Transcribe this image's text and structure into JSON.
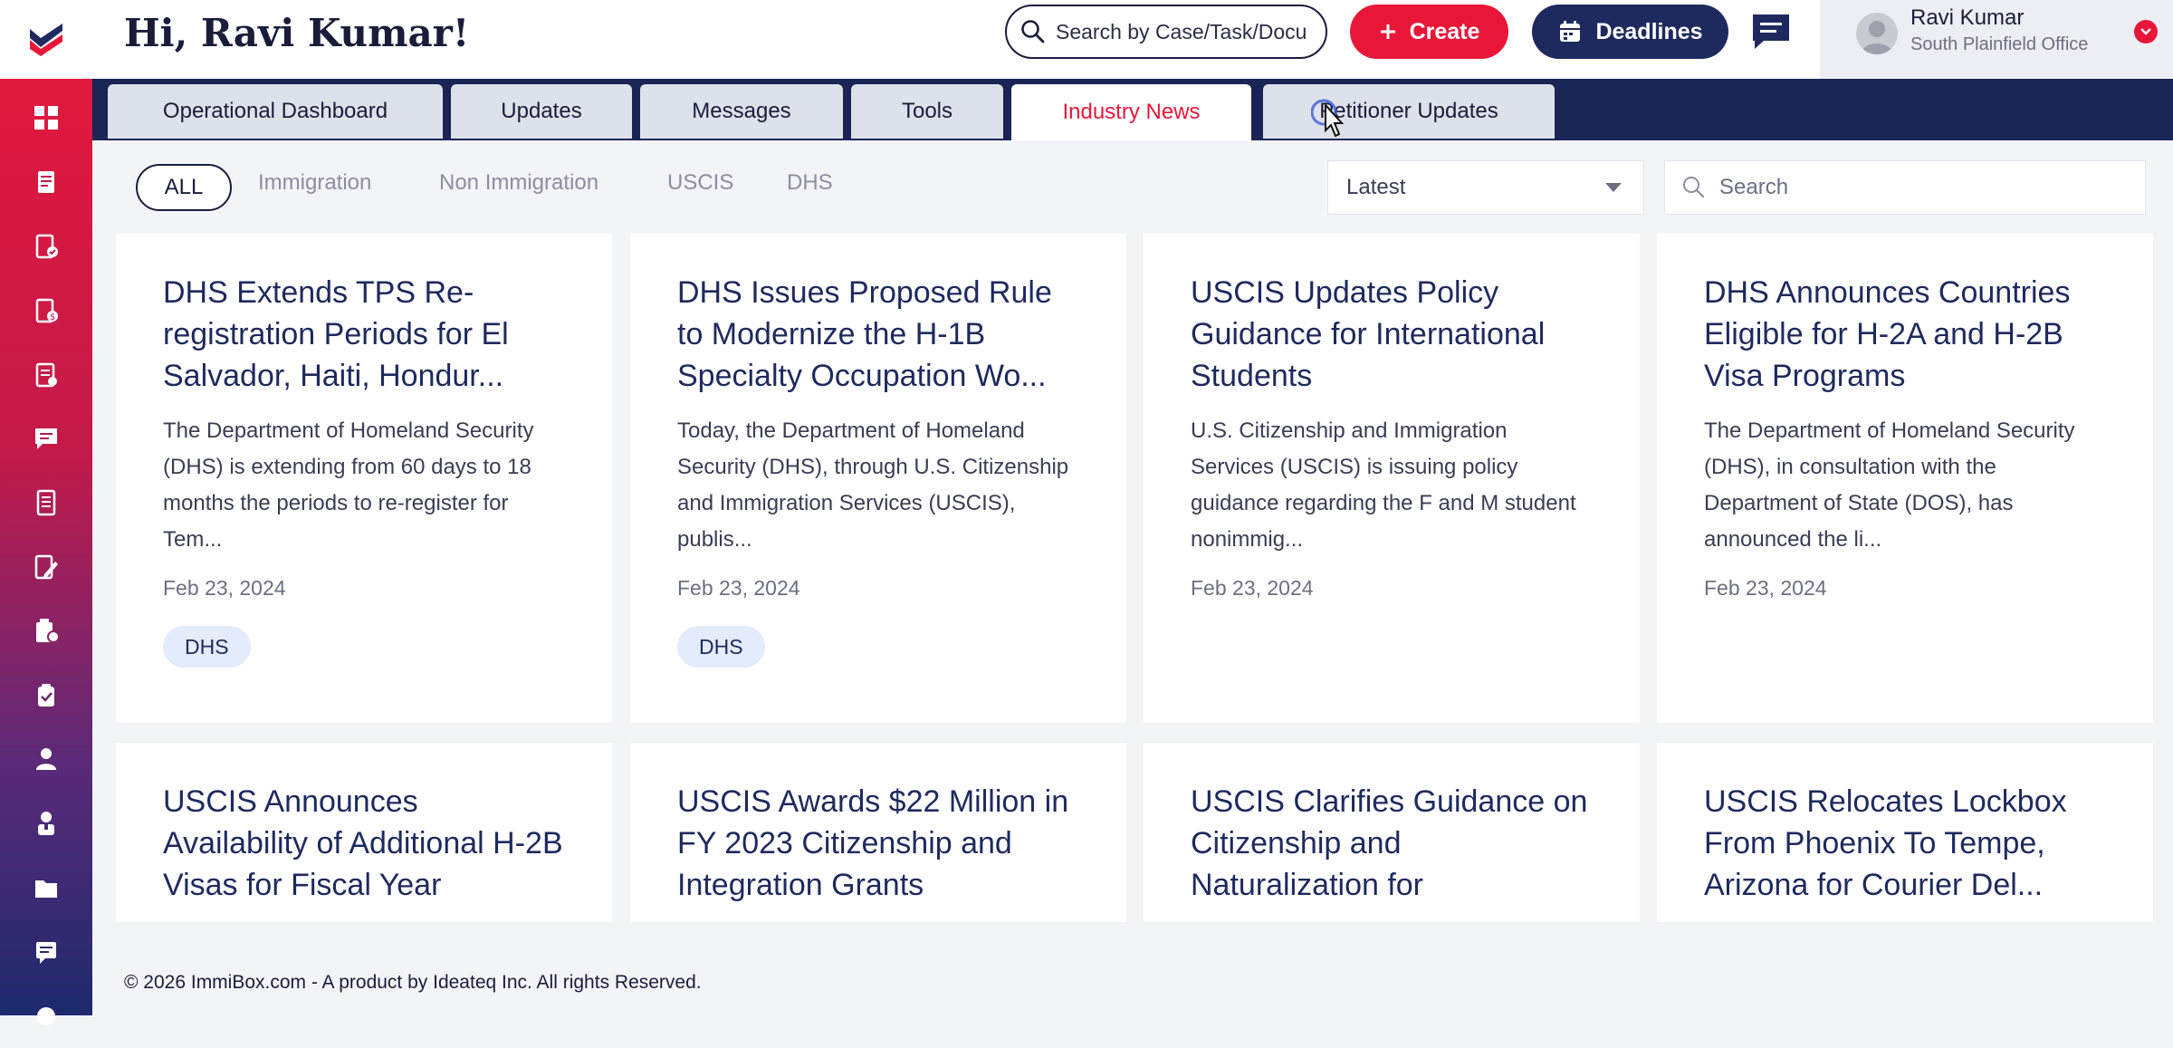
{
  "header": {
    "greeting": "Hi, Ravi Kumar!",
    "search_placeholder": "Search by Case/Task/Docu",
    "create_label": "Create",
    "deadlines_label": "Deadlines",
    "user_name": "Ravi Kumar",
    "user_office": "South Plainfield Office"
  },
  "sidebar": {
    "items": [
      {
        "icon": "dashboard-icon"
      },
      {
        "icon": "cases-icon"
      },
      {
        "icon": "forms-icon"
      },
      {
        "icon": "billing-icon"
      },
      {
        "icon": "checklist-icon"
      },
      {
        "icon": "messages-icon"
      },
      {
        "icon": "notes-icon"
      },
      {
        "icon": "edit-document-icon"
      },
      {
        "icon": "reports-icon"
      },
      {
        "icon": "tasks-icon"
      },
      {
        "icon": "user-icon"
      },
      {
        "icon": "contacts-icon"
      },
      {
        "icon": "folder-icon"
      },
      {
        "icon": "chat-icon"
      },
      {
        "icon": "help-icon"
      }
    ]
  },
  "tabs": [
    {
      "label": "Operational Dashboard",
      "active": false
    },
    {
      "label": "Updates",
      "active": false
    },
    {
      "label": "Messages",
      "active": false
    },
    {
      "label": "Tools",
      "active": false
    },
    {
      "label": "Industry News",
      "active": true
    },
    {
      "label": "Petitioner Updates",
      "active": false
    }
  ],
  "filters": {
    "chips": [
      "ALL",
      "Immigration",
      "Non Immigration",
      "USCIS",
      "DHS"
    ],
    "selected": "ALL",
    "sort_value": "Latest",
    "search_placeholder": "Search"
  },
  "articles": [
    {
      "title": "DHS Extends TPS Re-registration Periods for El Salvador, Haiti, Hondur...",
      "description": "The Department of Homeland Security (DHS) is extending from 60 days to 18 months the periods to re-register for Tem...",
      "date": "Feb 23, 2024",
      "tag": "DHS"
    },
    {
      "title": "DHS Issues Proposed Rule to Modernize the H-1B Specialty Occupation Wo...",
      "description": "Today, the Department of Homeland Security (DHS), through U.S. Citizenship and Immigration Services (USCIS), publis...",
      "date": "Feb 23, 2024",
      "tag": "DHS"
    },
    {
      "title": "USCIS Updates Policy Guidance for International Students",
      "description": "U.S. Citizenship and Immigration Services (USCIS) is issuing policy guidance regarding the F and M student nonimmig...",
      "date": "Feb 23, 2024",
      "tag": ""
    },
    {
      "title": "DHS Announces Countries Eligible for H-2A and H-2B Visa Programs",
      "description": "The Department of Homeland Security (DHS), in consultation with the Department of State (DOS), has announced the li...",
      "date": "Feb 23, 2024",
      "tag": ""
    },
    {
      "title": "USCIS Announces Availability of Additional H-2B Visas for Fiscal Year",
      "description": "",
      "date": "",
      "tag": ""
    },
    {
      "title": "USCIS Awards $22 Million in FY 2023 Citizenship and Integration Grants",
      "description": "",
      "date": "",
      "tag": ""
    },
    {
      "title": "USCIS Clarifies Guidance on Citizenship and Naturalization for",
      "description": "",
      "date": "",
      "tag": ""
    },
    {
      "title": "USCIS Relocates Lockbox From Phoenix To Tempe, Arizona for Courier Del...",
      "description": "",
      "date": "",
      "tag": ""
    }
  ],
  "footer": {
    "text": "© 2026 ImmiBox.com - A product by Ideateq Inc. All rights Reserved."
  },
  "colors": {
    "accent_red": "#e8173a",
    "navy": "#1e2a5e",
    "tab_bar": "#1b2555"
  }
}
